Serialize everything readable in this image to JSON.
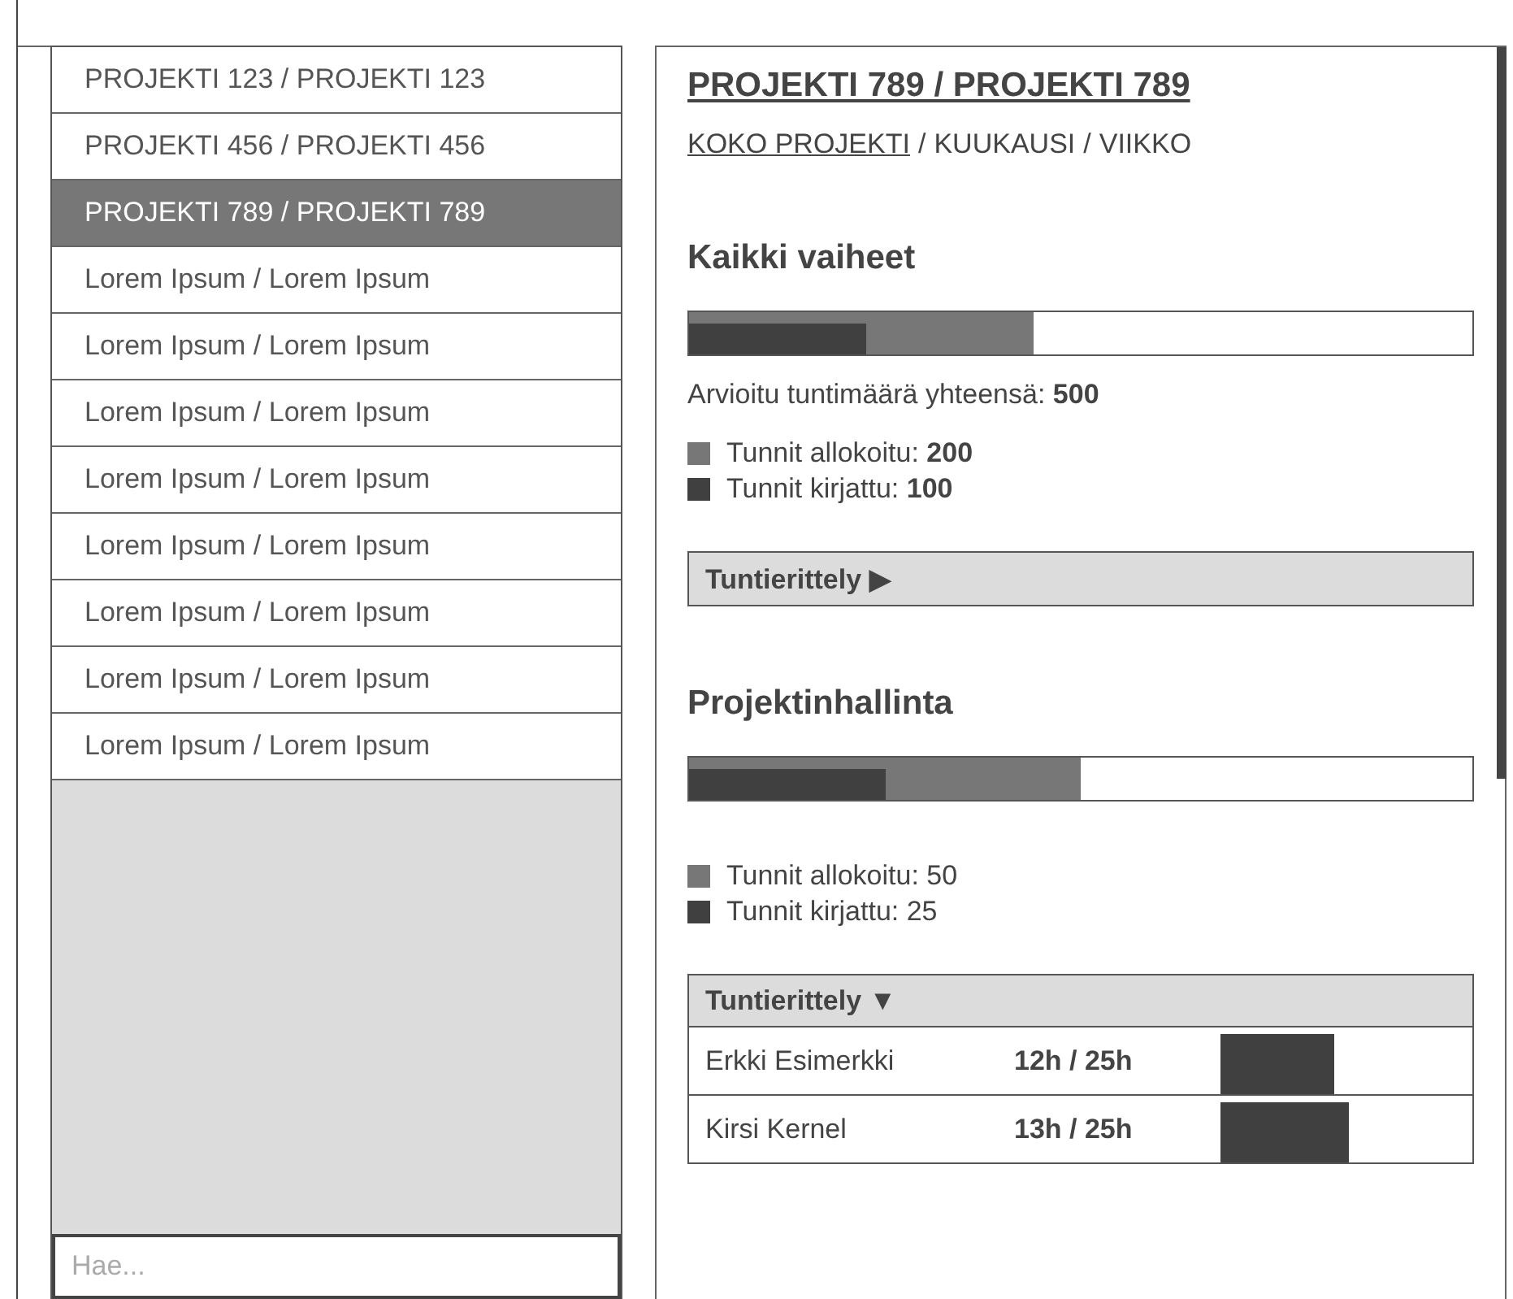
{
  "sidebar": {
    "items": [
      {
        "label": "PROJEKTI 123 / PROJEKTI 123",
        "selected": false
      },
      {
        "label": "PROJEKTI 456 / PROJEKTI 456",
        "selected": false
      },
      {
        "label": "PROJEKTI 789 / PROJEKTI 789",
        "selected": true
      },
      {
        "label": "Lorem Ipsum / Lorem Ipsum",
        "selected": false
      },
      {
        "label": "Lorem Ipsum / Lorem Ipsum",
        "selected": false
      },
      {
        "label": "Lorem Ipsum / Lorem Ipsum",
        "selected": false
      },
      {
        "label": "Lorem Ipsum / Lorem Ipsum",
        "selected": false
      },
      {
        "label": "Lorem Ipsum / Lorem Ipsum",
        "selected": false
      },
      {
        "label": "Lorem Ipsum / Lorem Ipsum",
        "selected": false
      },
      {
        "label": "Lorem Ipsum / Lorem Ipsum",
        "selected": false
      },
      {
        "label": "Lorem Ipsum / Lorem Ipsum",
        "selected": false
      }
    ],
    "search": {
      "placeholder": "Hae..."
    }
  },
  "detail": {
    "title": "PROJEKTI 789 / PROJEKTI 789",
    "separator": "/",
    "views": [
      {
        "label": "KOKO PROJEKTI",
        "selected": true
      },
      {
        "label": "KUUKAUSI",
        "selected": false
      },
      {
        "label": "VIIKKO",
        "selected": false
      }
    ],
    "sections": [
      {
        "title": "Kaikki vaiheet",
        "bars": [
          {
            "kind": "allocated",
            "level": 0.44
          },
          {
            "kind": "logged",
            "level": 0.227
          }
        ],
        "total": "Arvioitu tuntimäärä yhteensä: **500**",
        "legend": [
          "Tunnit allokoitu: **200**",
          "Tunnit kirjattu: **100**"
        ],
        "breakdown": {
          "label": "Tuntierittely",
          "toggle": "▶",
          "expanded": false
        }
      },
      {
        "title": "Projektinhallinta",
        "bars": [
          {
            "kind": "allocated",
            "level": 0.5
          },
          {
            "kind": "logged",
            "level": 0.25
          }
        ],
        "legend": [
          "Tunnit allokoitu: 50",
          "Tunnit kirjattu: 25"
        ],
        "breakdown": {
          "label": "Tuntierittely",
          "toggle": "▼",
          "expanded": true,
          "rows": [
            {
              "name": "Erkki Esimerkki",
              "hours": "12h / 25h"
            },
            {
              "name": "Kirsi Kernel",
              "hours": "13h / 25h"
            }
          ]
        }
      }
    ]
  }
}
